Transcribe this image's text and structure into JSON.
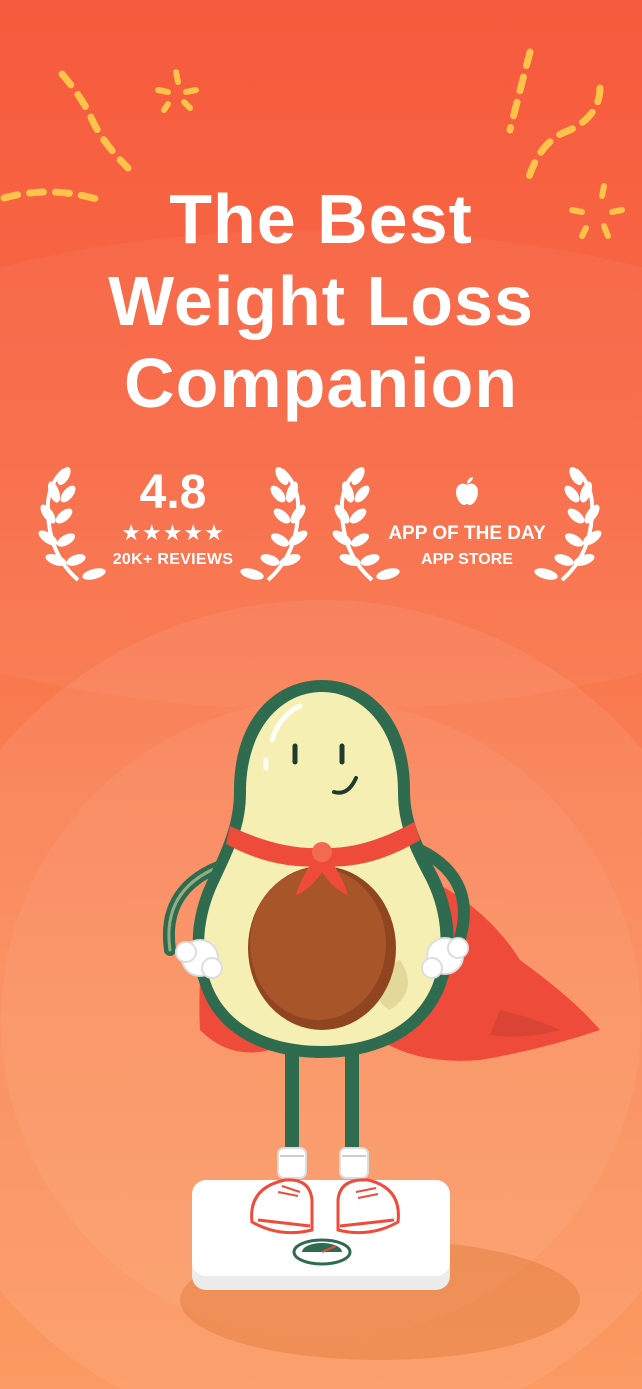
{
  "headline": {
    "line1": "The Best",
    "line2": "Weight Loss",
    "line3": "Companion"
  },
  "rating_badge": {
    "value": "4.8",
    "stars": "★★★★★",
    "stars_count": 5,
    "reviews": "20K+ REVIEWS"
  },
  "award_badge": {
    "icon": "apple-logo-icon",
    "title": "APP OF THE DAY",
    "subtitle": "APP STORE"
  },
  "illustration": {
    "subject": "avocado-superhero-on-scale",
    "icon": "avocado-mascot-icon"
  },
  "colors": {
    "background_top": "#f65a3c",
    "background_bottom": "#fb9a62",
    "text": "#ffffff",
    "doodle": "#ffc24a",
    "avocado_skin": "#2f6b4f",
    "avocado_flesh": "#f6efb3",
    "pit": "#a8552a",
    "cape": "#ef4b3b"
  }
}
